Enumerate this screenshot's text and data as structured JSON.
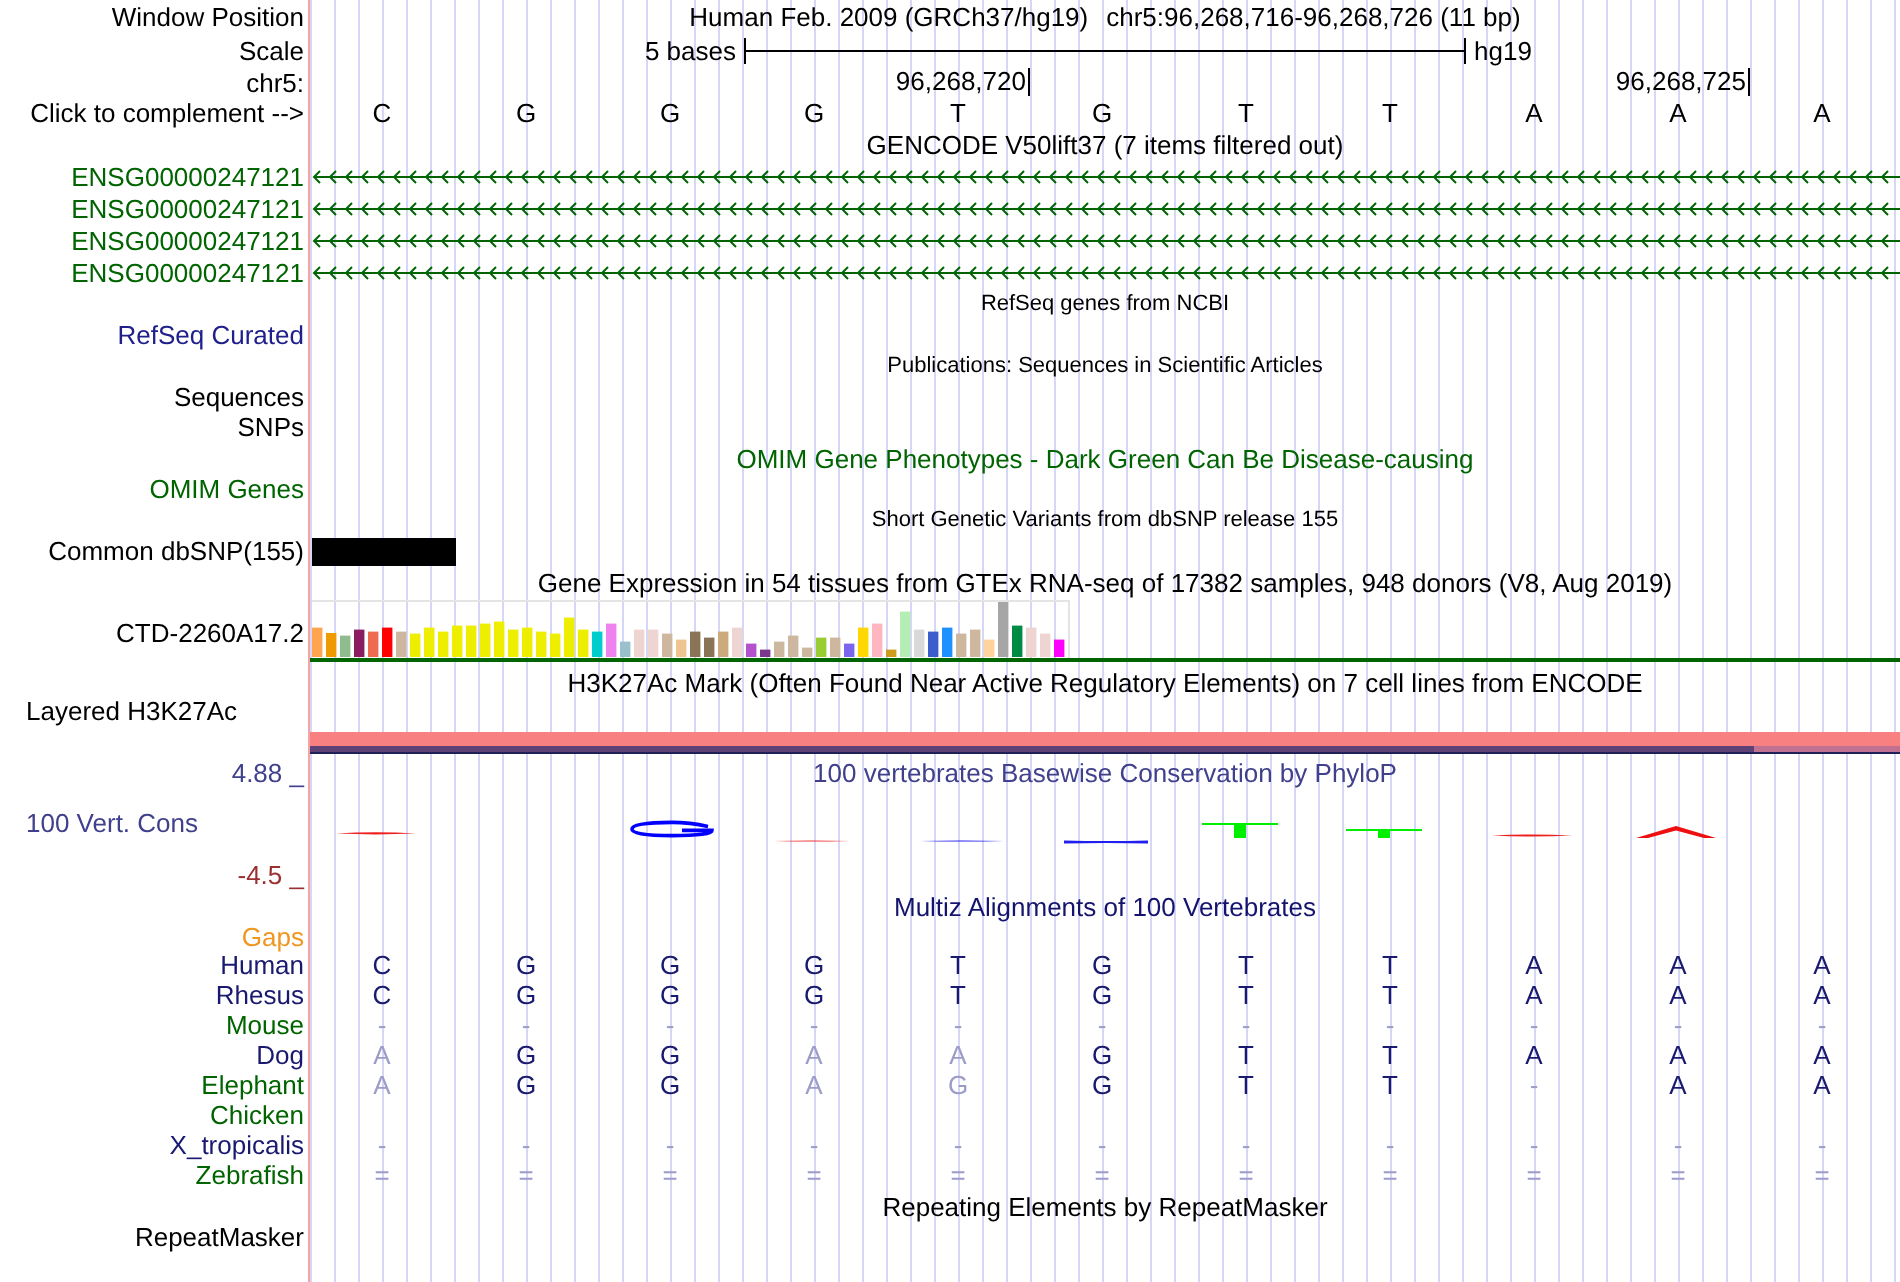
{
  "rows": [
    {
      "kind": "position",
      "label": "Window Position",
      "assembly": "Human Feb. 2009 (GRCh37/hg19)",
      "range": "chr5:96,268,716-96,268,726 (11 bp)"
    },
    {
      "kind": "scale",
      "label": "Scale",
      "span": "5 bases",
      "assembly": "hg19"
    },
    {
      "kind": "coordinates",
      "label": "chr5:",
      "ticks": [
        "96,268,720",
        "96,268,725"
      ]
    },
    {
      "kind": "bases",
      "label": "Click to complement -->",
      "bases": [
        "C",
        "G",
        "G",
        "G",
        "T",
        "G",
        "T",
        "T",
        "A",
        "A",
        "A"
      ]
    },
    {
      "kind": "title",
      "title": "GENCODE V50lift37 (7 items filtered out)"
    },
    {
      "kind": "gene",
      "label": "ENSG00000247121",
      "color": "#006400",
      "reverse_strand": true
    },
    {
      "kind": "gene",
      "label": "ENSG00000247121",
      "color": "#006400",
      "reverse_strand": true
    },
    {
      "kind": "gene",
      "label": "ENSG00000247121",
      "color": "#006400",
      "reverse_strand": true
    },
    {
      "kind": "gene",
      "label": "ENSG00000247121",
      "color": "#006400",
      "reverse_strand": true
    },
    {
      "kind": "subtitle",
      "title": "RefSeq genes from NCBI"
    },
    {
      "kind": "track",
      "label": "RefSeq Curated",
      "color": "#20208c"
    },
    {
      "kind": "subtitle",
      "title": "Publications: Sequences in Scientific Articles"
    },
    {
      "kind": "track",
      "label": "Sequences"
    },
    {
      "kind": "track",
      "label": "SNPs"
    },
    {
      "kind": "title",
      "title": "OMIM Gene Phenotypes - Dark Green Can Be Disease-causing",
      "color": "#006400"
    },
    {
      "kind": "track",
      "label": "OMIM Genes",
      "color": "#006400"
    },
    {
      "kind": "subtitle",
      "title": "Short Genetic Variants from dbSNP release 155"
    },
    {
      "kind": "variant",
      "label": "Common dbSNP(155)"
    },
    {
      "kind": "title",
      "title": "Gene Expression in 54 tissues from GTEx RNA-seq of 17382 samples, 948 donors (V8, Aug 2019)"
    },
    {
      "kind": "expression",
      "label": "CTD-2260A17.2"
    },
    {
      "kind": "title",
      "title": "H3K27Ac Mark (Often Found Near Active Regulatory Elements) on 7 cell lines from ENCODE"
    },
    {
      "kind": "layered",
      "label": "Layered H3K27Ac"
    },
    {
      "kind": "conservation",
      "title": "100 vertebrates Basewise Conservation by PhyloP",
      "max_label": "4.88 _",
      "label": "100 Vert. Cons",
      "min_label": "-4.5 _",
      "color": "#40408c"
    },
    {
      "kind": "alignment",
      "title": "Multiz Alignments of 100 Vertebrates",
      "color": "#14146e",
      "gaps": {
        "label": "Gaps",
        "color": "#f0961e"
      },
      "species": [
        {
          "name": "Human",
          "color": "#191970",
          "bases": [
            {
              "base": "C",
              "match": true
            },
            {
              "base": "G",
              "match": true
            },
            {
              "base": "G",
              "match": true
            },
            {
              "base": "G",
              "match": true
            },
            {
              "base": "T",
              "match": true
            },
            {
              "base": "G",
              "match": true
            },
            {
              "base": "T",
              "match": true
            },
            {
              "base": "T",
              "match": true
            },
            {
              "base": "A",
              "match": true
            },
            {
              "base": "A",
              "match": true
            },
            {
              "base": "A",
              "match": true
            }
          ]
        },
        {
          "name": "Rhesus",
          "color": "#191970",
          "bases": [
            {
              "base": "C",
              "match": true
            },
            {
              "base": "G",
              "match": true
            },
            {
              "base": "G",
              "match": true
            },
            {
              "base": "G",
              "match": true
            },
            {
              "base": "T",
              "match": true
            },
            {
              "base": "G",
              "match": true
            },
            {
              "base": "T",
              "match": true
            },
            {
              "base": "T",
              "match": true
            },
            {
              "base": "A",
              "match": true
            },
            {
              "base": "A",
              "match": true
            },
            {
              "base": "A",
              "match": true
            }
          ]
        },
        {
          "name": "Mouse",
          "color": "#006400",
          "bases": [
            {
              "base": "-",
              "match": false
            },
            {
              "base": "-",
              "match": false
            },
            {
              "base": "-",
              "match": false
            },
            {
              "base": "-",
              "match": false
            },
            {
              "base": "-",
              "match": false
            },
            {
              "base": "-",
              "match": false
            },
            {
              "base": "-",
              "match": false
            },
            {
              "base": "-",
              "match": false
            },
            {
              "base": "-",
              "match": false
            },
            {
              "base": "-",
              "match": false
            },
            {
              "base": "-",
              "match": false
            }
          ]
        },
        {
          "name": "Dog",
          "color": "#191970",
          "bases": [
            {
              "base": "A",
              "match": false
            },
            {
              "base": "G",
              "match": true
            },
            {
              "base": "G",
              "match": true
            },
            {
              "base": "A",
              "match": false
            },
            {
              "base": "A",
              "match": false
            },
            {
              "base": "G",
              "match": true
            },
            {
              "base": "T",
              "match": true
            },
            {
              "base": "T",
              "match": true
            },
            {
              "base": "A",
              "match": true
            },
            {
              "base": "A",
              "match": true
            },
            {
              "base": "A",
              "match": true
            }
          ]
        },
        {
          "name": "Elephant",
          "color": "#006400",
          "bases": [
            {
              "base": "A",
              "match": false
            },
            {
              "base": "G",
              "match": true
            },
            {
              "base": "G",
              "match": true
            },
            {
              "base": "A",
              "match": false
            },
            {
              "base": "G",
              "match": false
            },
            {
              "base": "G",
              "match": true
            },
            {
              "base": "T",
              "match": true
            },
            {
              "base": "T",
              "match": true
            },
            {
              "base": "-",
              "match": false
            },
            {
              "base": "A",
              "match": true
            },
            {
              "base": "A",
              "match": true
            }
          ]
        },
        {
          "name": "Chicken",
          "color": "#006400"
        },
        {
          "name": "X_tropicalis",
          "color": "#191970",
          "bases": [
            {
              "base": "-",
              "match": false
            },
            {
              "base": "-",
              "match": false
            },
            {
              "base": "-",
              "match": false
            },
            {
              "base": "-",
              "match": false
            },
            {
              "base": "-",
              "match": false
            },
            {
              "base": "-",
              "match": false
            },
            {
              "base": "-",
              "match": false
            },
            {
              "base": "-",
              "match": false
            },
            {
              "base": "-",
              "match": false
            },
            {
              "base": "-",
              "match": false
            },
            {
              "base": "-",
              "match": false
            }
          ]
        },
        {
          "name": "Zebrafish",
          "color": "#006400",
          "bases": [
            {
              "base": "=",
              "match": false
            },
            {
              "base": "=",
              "match": false
            },
            {
              "base": "=",
              "match": false
            },
            {
              "base": "=",
              "match": false
            },
            {
              "base": "=",
              "match": false
            },
            {
              "base": "=",
              "match": false
            },
            {
              "base": "=",
              "match": false
            },
            {
              "base": "=",
              "match": false
            },
            {
              "base": "=",
              "match": false
            },
            {
              "base": "=",
              "match": false
            },
            {
              "base": "=",
              "match": false
            }
          ]
        }
      ]
    },
    {
      "kind": "title",
      "title": "Repeating Elements by RepeatMasker"
    },
    {
      "kind": "track",
      "label": "RepeatMasker"
    }
  ]
}
